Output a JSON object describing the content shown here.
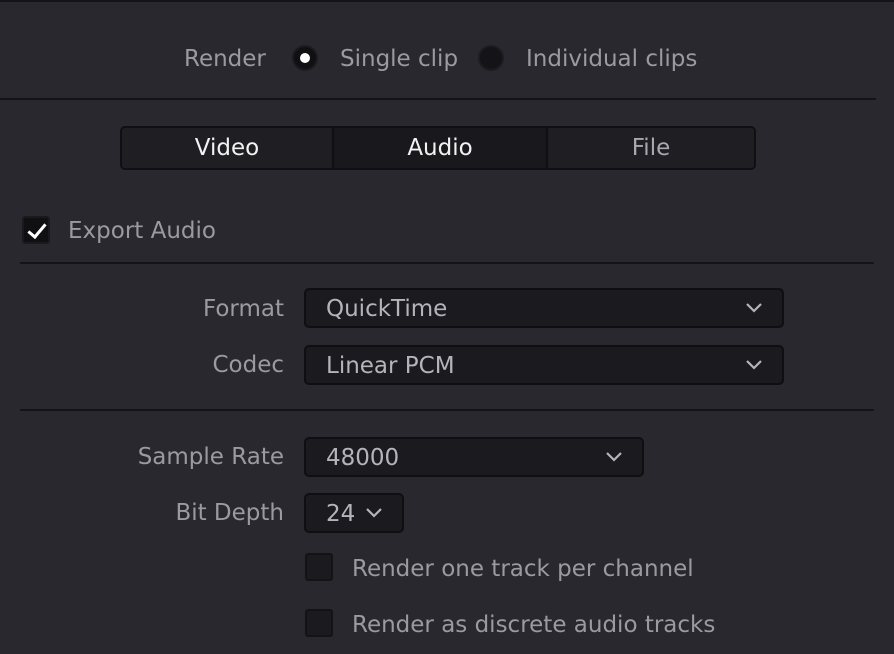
{
  "render": {
    "label": "Render",
    "options": [
      {
        "label": "Single clip",
        "selected": true
      },
      {
        "label": "Individual clips",
        "selected": false
      }
    ]
  },
  "tabs": [
    {
      "label": "Video",
      "active": false
    },
    {
      "label": "Audio",
      "active": true
    },
    {
      "label": "File",
      "active": false
    }
  ],
  "export_audio": {
    "label": "Export Audio",
    "checked": true
  },
  "format": {
    "label": "Format",
    "value": "QuickTime"
  },
  "codec": {
    "label": "Codec",
    "value": "Linear PCM"
  },
  "sample_rate": {
    "label": "Sample Rate",
    "value": "48000"
  },
  "bit_depth": {
    "label": "Bit Depth",
    "value": "24"
  },
  "options": [
    {
      "label": "Render one track per channel",
      "checked": false
    },
    {
      "label": "Render as discrete audio tracks",
      "checked": false
    }
  ],
  "colors": {
    "background": "#28282e",
    "text": "#9a9aa0",
    "active_text": "#f2f2f2",
    "control_bg": "#1a1a1f",
    "divider": "#141417"
  },
  "icons": {
    "dropdown": "chevron-down-icon",
    "checkmark": "checkmark-icon",
    "radio_dot": "radio-dot-icon"
  }
}
